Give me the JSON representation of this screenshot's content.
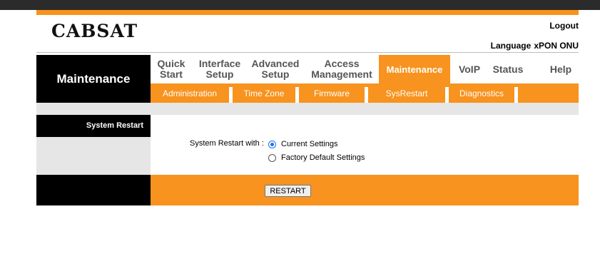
{
  "brand": {
    "logo": "CABSAT"
  },
  "header": {
    "logout": "Logout",
    "language_label": "Language",
    "language_value": "xPON ONU"
  },
  "menu": {
    "section_title": "Maintenance",
    "nav": [
      {
        "label": "Quick\nStart"
      },
      {
        "label": "Interface\nSetup"
      },
      {
        "label": "Advanced\nSetup"
      },
      {
        "label": "Access\nManagement"
      },
      {
        "label": "Maintenance"
      },
      {
        "label": "VoIP"
      },
      {
        "label": "Status"
      },
      {
        "label": "Help"
      }
    ],
    "subnav": [
      {
        "label": "Administration"
      },
      {
        "label": "Time Zone"
      },
      {
        "label": "Firmware"
      },
      {
        "label": "SysRestart"
      },
      {
        "label": "Diagnostics"
      }
    ]
  },
  "content": {
    "section_heading": "System Restart",
    "restart_with_label": "System Restart with :",
    "options": [
      {
        "label": "Current Settings",
        "selected": true
      },
      {
        "label": "Factory Default Settings",
        "selected": false
      }
    ],
    "restart_button": "RESTART"
  },
  "colors": {
    "accent": "#f7931e",
    "dark": "#000000",
    "panel": "#e6e6e6"
  }
}
